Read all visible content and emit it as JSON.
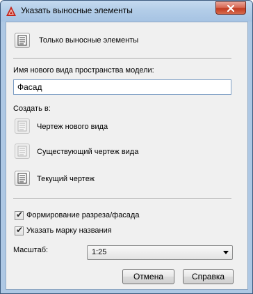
{
  "window": {
    "title": "Указать выносные элементы"
  },
  "options": {
    "callout_only_label": "Только выносные элементы"
  },
  "view_name": {
    "label": "Имя нового вида пространства модели:",
    "value": "Фасад"
  },
  "create_in": {
    "label": "Создать в:",
    "items": [
      {
        "label": "Чертеж нового вида",
        "enabled": false
      },
      {
        "label": "Существующий чертеж вида",
        "enabled": false
      },
      {
        "label": "Текущий чертеж",
        "enabled": true
      }
    ]
  },
  "checkboxes": [
    {
      "label": "Формирование разреза/фасада",
      "checked": true
    },
    {
      "label": "Указать марку названия",
      "checked": true
    }
  ],
  "scale": {
    "label": "Масштаб:",
    "value": "1:25"
  },
  "buttons": {
    "cancel": "Отмена",
    "help": "Справка"
  },
  "colors": {
    "titlebar": "#b3cde8",
    "close_button": "#c0381f",
    "client_bg": "#f0f0f0"
  }
}
